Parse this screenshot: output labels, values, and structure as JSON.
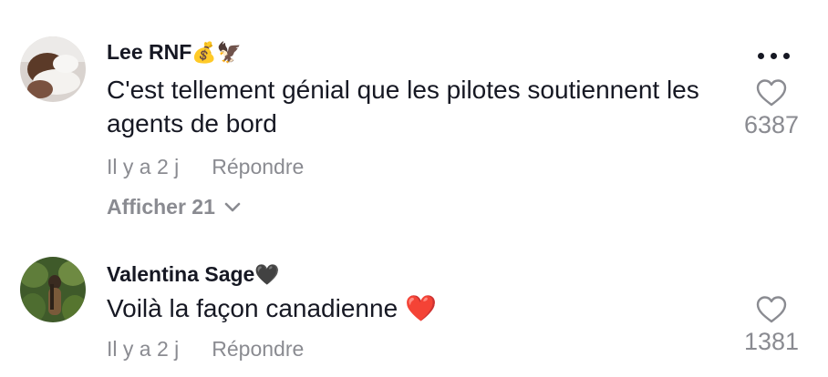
{
  "comments": [
    {
      "username": "Lee RNF",
      "username_emoji": "💰🦅",
      "text": "C'est tellement génial que les pilotes soutiennent les agents de bord",
      "time": "Il y a 2 j",
      "reply_label": "Répondre",
      "view_replies_label": "Afficher 21",
      "like_count": "6387",
      "more_icon": "more-dots-icon",
      "like_icon": "heart-outline-icon"
    },
    {
      "username": "Valentina Sage",
      "username_emoji": "🖤",
      "text": "Voilà la façon canadienne",
      "text_emoji": "❤️",
      "time": "Il y a 2 j",
      "reply_label": "Répondre",
      "like_count": "1381",
      "like_icon": "heart-outline-icon"
    }
  ],
  "colors": {
    "text_primary": "#161823",
    "text_secondary": "#8a8b91",
    "heart_emoji": "#e2162f"
  }
}
